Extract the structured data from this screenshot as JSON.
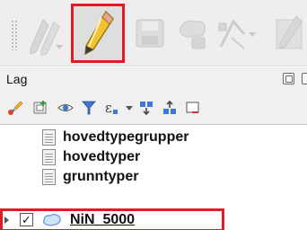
{
  "toolbar": {
    "buttons": [
      {
        "name": "edits-dropdown",
        "icon": "pencils-icon",
        "state": "disabled"
      },
      {
        "name": "toggle-editing",
        "icon": "pencil-icon",
        "state": "active-highlighted"
      },
      {
        "name": "save-layer-edits",
        "icon": "save-icon",
        "state": "disabled"
      },
      {
        "name": "add-feature",
        "icon": "add-polygon-icon",
        "state": "disabled"
      },
      {
        "name": "vertex-tool",
        "icon": "vertex-tool-icon",
        "state": "disabled"
      },
      {
        "name": "modify-attributes",
        "icon": "modify-attributes-icon",
        "state": "disabled"
      }
    ]
  },
  "panel": {
    "title": "Lag"
  },
  "layer_panel_toolbar": {
    "icons": [
      "open-styling-icon",
      "add-group-icon",
      "manage-visibility-icon",
      "filter-icon",
      "filter-expression-icon",
      "expand-all-icon",
      "collapse-all-icon",
      "remove-layer-icon"
    ]
  },
  "layers": [
    {
      "label": "hovedtypegrupper",
      "type": "table",
      "checked": null
    },
    {
      "label": "hovedtyper",
      "type": "table",
      "checked": null
    },
    {
      "label": "grunntyper",
      "type": "table",
      "checked": null
    },
    {
      "label": "NiN_5000",
      "type": "polygon",
      "checked": true,
      "check_glyph": "✓",
      "highlighted": true
    }
  ],
  "colors": {
    "highlight": "#e01b24",
    "pencil": "#f2c230",
    "polygon_fill": "#cfe3f6",
    "polygon_stroke": "#6f9fd8"
  }
}
